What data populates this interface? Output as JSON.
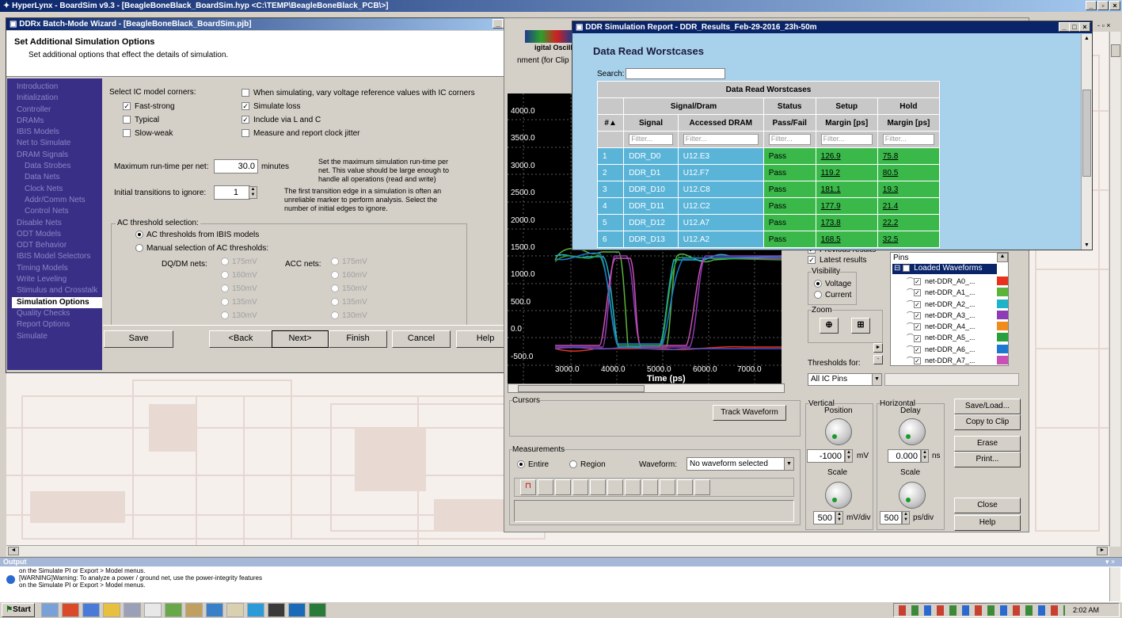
{
  "app_title": "HyperLynx - BoardSim v9.3 - [BeagleBoneBlack_BoardSim.hyp <C:\\TEMP\\BeagleBoneBlack_PCB\\>]",
  "wizard": {
    "title": "DDRx Batch-Mode Wizard - [BeagleBoneBlack_BoardSim.pjb]",
    "header_title": "Set Additional Simulation Options",
    "header_sub": "Set additional options that effect the details of simulation.",
    "nav": [
      {
        "label": "Introduction",
        "sub": false
      },
      {
        "label": "Initialization",
        "sub": false
      },
      {
        "label": "Controller",
        "sub": false
      },
      {
        "label": "DRAMs",
        "sub": false
      },
      {
        "label": "IBIS Models",
        "sub": false
      },
      {
        "label": "Net to Simulate",
        "sub": false
      },
      {
        "label": "DRAM Signals",
        "sub": false
      },
      {
        "label": "Data Strobes",
        "sub": true
      },
      {
        "label": "Data Nets",
        "sub": true
      },
      {
        "label": "Clock Nets",
        "sub": true
      },
      {
        "label": "Addr/Comm Nets",
        "sub": true
      },
      {
        "label": "Control Nets",
        "sub": true
      },
      {
        "label": "Disable Nets",
        "sub": false
      },
      {
        "label": "ODT Models",
        "sub": false
      },
      {
        "label": "ODT Behavior",
        "sub": false
      },
      {
        "label": "IBIS Model Selectors",
        "sub": false
      },
      {
        "label": "Timing Models",
        "sub": false
      },
      {
        "label": "Write Leveling",
        "sub": false
      },
      {
        "label": "Stimulus and Crosstalk",
        "sub": false
      },
      {
        "label": "Simulation Options",
        "sub": false,
        "active": true
      },
      {
        "label": "Quality Checks",
        "sub": false
      },
      {
        "label": "Report Options",
        "sub": false
      },
      {
        "label": "Simulate",
        "sub": false
      }
    ],
    "ic_corners_label": "Select IC model corners:",
    "corner_fast": "Fast-strong",
    "corner_typical": "Typical",
    "corner_slow": "Slow-weak",
    "opt_vref": "When simulating, vary voltage reference values with IC corners",
    "opt_loss": "Simulate loss",
    "opt_via": "Include via L and C",
    "opt_jitter": "Measure and report clock jitter",
    "max_runtime_label": "Maximum run-time per net:",
    "max_runtime_value": "30.0",
    "max_runtime_unit": "minutes",
    "max_runtime_help": "Set the maximum simulation run-time per net. This value should be large enough to handle all operations (read and write)",
    "init_trans_label": "Initial transitions to ignore:",
    "init_trans_value": "1",
    "init_trans_help": "The first transition edge in a simulation is often an unreliable marker to perform analysis. Select the number of initial edges to ignore.",
    "ac_group": "AC threshold selection:",
    "ac_ibis": "AC thresholds from IBIS models",
    "ac_manual": "Manual selection of AC thresholds:",
    "dq_label": "DQ/DM nets:",
    "acc_label": "ACC nets:",
    "thresholds": [
      "175mV",
      "160mV",
      "150mV",
      "135mV",
      "130mV"
    ],
    "btn_save": "Save",
    "btn_back": "<Back",
    "btn_next": "Next>",
    "btn_finish": "Finish",
    "btn_cancel": "Cancel",
    "btn_help": "Help"
  },
  "report": {
    "title": "DDR Simulation Report - DDR_Results_Feb-29-2016_23h-50m",
    "heading": "Data Read Worstcases",
    "search_label": "Search:",
    "table_title": "Data Read Worstcases",
    "group_signal": "Signal/Dram",
    "group_status": "Status",
    "group_setup": "Setup",
    "group_hold": "Hold",
    "col_num": "#▲",
    "col_signal": "Signal",
    "col_dram": "Accessed DRAM",
    "col_pass": "Pass/Fail",
    "col_setup": "Margin [ps]",
    "col_hold": "Margin [ps]",
    "filter": "Filter...",
    "rows": [
      {
        "n": "1",
        "signal": "DDR_D0",
        "dram": "U12.E3",
        "status": "Pass",
        "setup": "126.9",
        "hold": "75.8"
      },
      {
        "n": "2",
        "signal": "DDR_D1",
        "dram": "U12.F7",
        "status": "Pass",
        "setup": "119.2",
        "hold": "80.5"
      },
      {
        "n": "3",
        "signal": "DDR_D10",
        "dram": "U12.C8",
        "status": "Pass",
        "setup": "181.1",
        "hold": "19.3"
      },
      {
        "n": "4",
        "signal": "DDR_D11",
        "dram": "U12.C2",
        "status": "Pass",
        "setup": "177.9",
        "hold": "21.4"
      },
      {
        "n": "5",
        "signal": "DDR_D12",
        "dram": "U12.A7",
        "status": "Pass",
        "setup": "173.8",
        "hold": "22.2"
      },
      {
        "n": "6",
        "signal": "DDR_D13",
        "dram": "U12.A2",
        "status": "Pass",
        "setup": "168.5",
        "hold": "32.5"
      }
    ]
  },
  "scope": {
    "tab_title": "igital Oscillosco",
    "tab_sub": "nment (for Clip",
    "yticks": [
      "4000.0",
      "3500.0",
      "3000.0",
      "2500.0",
      "2000.0",
      "1500.0",
      "1000.0",
      "500.0",
      "0.0",
      "-500.0"
    ],
    "xticks": [
      "3000.0",
      "4000.0",
      "5000.0",
      "6000.0",
      "7000.0"
    ],
    "xlabel": "Time  (ps)",
    "previous_results": "Previous results",
    "latest_results": "Latest results",
    "visibility": "Visibility",
    "voltage": "Voltage",
    "current": "Current",
    "zoom": "Zoom",
    "pins_label": "Pins",
    "loaded_waveforms": "Loaded Waveforms",
    "waveforms": [
      {
        "name": "net-DDR_A0_...",
        "color": "#e8321e"
      },
      {
        "name": "net-DDR_A1_...",
        "color": "#5ab43c"
      },
      {
        "name": "net-DDR_A2_...",
        "color": "#1eb4c8"
      },
      {
        "name": "net-DDR_A3_...",
        "color": "#8c3cb4"
      },
      {
        "name": "net-DDR_A4_...",
        "color": "#f08c1e"
      },
      {
        "name": "net-DDR_A5_...",
        "color": "#28a03c"
      },
      {
        "name": "net-DDR_A6_...",
        "color": "#1e78d2"
      },
      {
        "name": "net-DDR_A7_...",
        "color": "#c850b4"
      }
    ],
    "thresholds_for": "Thresholds for:",
    "thresholds_value": "All IC Pins",
    "cursors": "Cursors",
    "track_waveform": "Track Waveform",
    "measurements": "Measurements",
    "entire": "Entire",
    "region": "Region",
    "waveform_label": "Waveform:",
    "waveform_value": "No waveform selected",
    "vertical": "Vertical",
    "position": "Position",
    "v_position_value": "-1000",
    "v_unit": "mV",
    "scale": "Scale",
    "v_scale_value": "500",
    "v_scale_unit": "mV/div",
    "horizontal": "Horizontal",
    "delay": "Delay",
    "h_delay_value": "0.000",
    "h_unit": "ns",
    "h_scale_value": "500",
    "h_scale_unit": "ps/div",
    "btn_save_load": "Save/Load...",
    "btn_copy": "Copy to Clip",
    "btn_erase": "Erase",
    "btn_print": "Print...",
    "btn_close": "Close",
    "btn_help": "Help"
  },
  "output": {
    "title": "Output",
    "lines": [
      "on the Simulate PI or Export > Model menus.",
      "[WARNING]Warning: To analyze a power / ground net, use the power-integrity features",
      "on the Simulate PI or Export > Model menus."
    ]
  },
  "taskbar": {
    "start": "Start",
    "clock": "2:02 AM"
  }
}
